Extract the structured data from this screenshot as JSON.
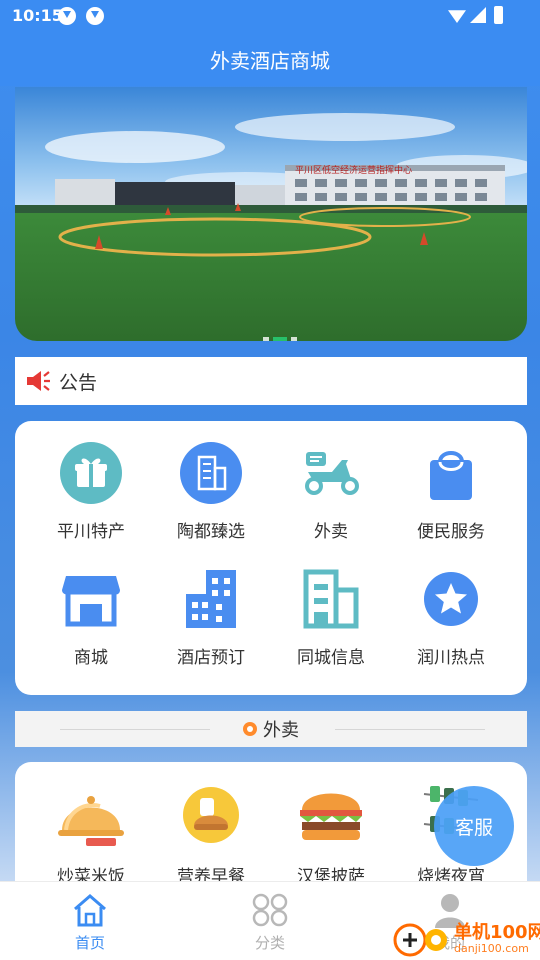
{
  "status_bar": {
    "time": "10:15",
    "icons": [
      "download-icon",
      "download-icon",
      "wifi-icon",
      "signal-icon",
      "battery-icon"
    ]
  },
  "header": {
    "title": "外卖酒店商城"
  },
  "banner": {
    "caption": "平川区低空经济运营指挥中心",
    "pager": {
      "count": 3,
      "active": 2
    }
  },
  "notice": {
    "label": "公告",
    "icon": "megaphone-icon"
  },
  "categories": [
    {
      "label": "平川特产",
      "icon": "gift-icon"
    },
    {
      "label": "陶都臻选",
      "icon": "building-icon"
    },
    {
      "label": "外卖",
      "icon": "scooter-icon"
    },
    {
      "label": "便民服务",
      "icon": "shopping-bag-icon"
    },
    {
      "label": "商城",
      "icon": "storefront-icon"
    },
    {
      "label": "酒店预订",
      "icon": "hotel-icon"
    },
    {
      "label": "同城信息",
      "icon": "city-building-icon"
    },
    {
      "label": "润川热点",
      "icon": "star-icon"
    }
  ],
  "takeout_section": {
    "title": "外卖",
    "items": [
      {
        "label": "炒菜米饭",
        "icon": "cloche-icon"
      },
      {
        "label": "营养早餐",
        "icon": "bread-icon"
      },
      {
        "label": "汉堡披萨",
        "icon": "burger-icon"
      },
      {
        "label": "烧烤夜宵",
        "icon": "skewer-icon"
      }
    ]
  },
  "service_button": {
    "label": "客服"
  },
  "bottom_nav": {
    "items": [
      {
        "label": "首页",
        "icon": "home-icon",
        "active": true
      },
      {
        "label": "分类",
        "icon": "category-icon",
        "active": false
      },
      {
        "label": "我的",
        "icon": "user-icon",
        "active": false
      }
    ]
  },
  "watermark": {
    "title": "单机100网",
    "url": "danji100.com"
  },
  "colors": {
    "primary": "#3b8cf2",
    "icon_blue": "#4a8df0",
    "icon_teal": "#5ebbc4",
    "accent_orange": "#ff8b2c"
  }
}
